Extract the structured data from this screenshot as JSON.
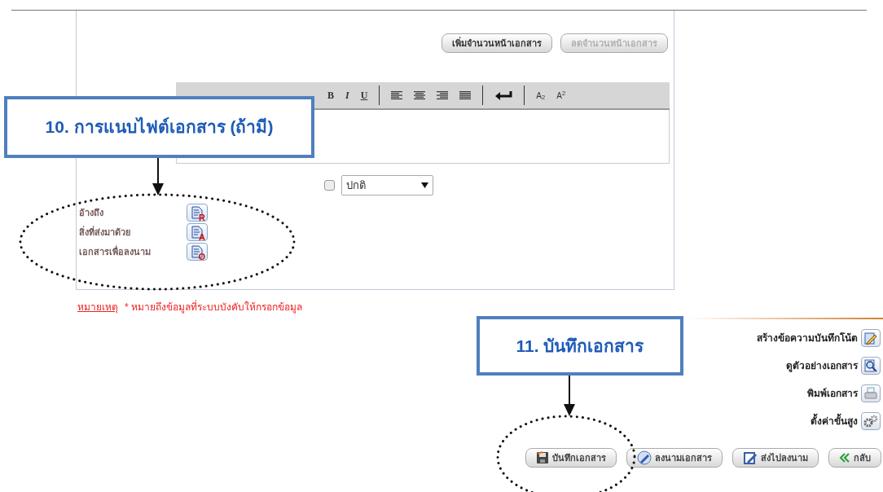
{
  "page_buttons": [
    {
      "label": "เพิ่มจำนวนหน้าเอกสาร",
      "disabled": false
    },
    {
      "label": "ลดจำนวนหน้าเอกสาร",
      "disabled": true
    }
  ],
  "format_buttons": [
    "B",
    "I",
    "U"
  ],
  "script_buttons": [
    "A$_{2}$",
    "A$^{2}$"
  ],
  "style_checkbox": {
    "checked": false
  },
  "style_select": {
    "value": "ปกติ"
  },
  "attachments": [
    {
      "label": "อ้างถึง",
      "badge": "R"
    },
    {
      "label": "สิ่งที่ส่งมาด้วย",
      "badge": "A"
    },
    {
      "label": "เอกสารเพื่อลงนาม",
      "badge": "O"
    }
  ],
  "note": {
    "label": "หมายเหตุ",
    "text": "* หมายถึงข้อมูลที่ระบบบังคับให้กรอกข้อมูล"
  },
  "actions": [
    {
      "label": "สร้างข้อความบันทึกโน้ต",
      "kind": "note"
    },
    {
      "label": "ดูตัวอย่างเอกสาร",
      "kind": "preview"
    },
    {
      "label": "พิมพ์เอกสาร",
      "kind": "print"
    },
    {
      "label": "ตั้งค่าขั้นสูง",
      "kind": "settings"
    }
  ],
  "buttons": [
    {
      "label": "บันทึกเอกสาร",
      "kind": "save"
    },
    {
      "label": "ลงนามเอกสาร",
      "kind": "sign"
    },
    {
      "label": "ส่งไปลงนาม",
      "kind": "send"
    },
    {
      "label": "กลับ",
      "kind": "back"
    }
  ],
  "callouts": [
    "10. การแนบไฟต์เอกสาร (ถ้ามี)",
    "11. บันทึกเอกสาร"
  ]
}
